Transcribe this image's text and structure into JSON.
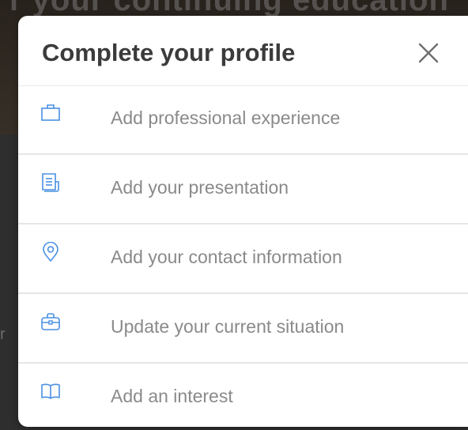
{
  "backdrop": {
    "heading_fragment": "r your continuing education",
    "side_fragment": "r"
  },
  "modal": {
    "title": "Complete your profile",
    "close_icon": "close-icon",
    "accent_color": "#4a90e2",
    "items": [
      {
        "label": "Add professional experience",
        "icon": "briefcase-icon"
      },
      {
        "label": "Add your presentation",
        "icon": "document-icon"
      },
      {
        "label": "Add your contact information",
        "icon": "location-pin-icon"
      },
      {
        "label": "Update your current situation",
        "icon": "toolbox-icon"
      },
      {
        "label": "Add an interest",
        "icon": "open-book-icon"
      }
    ]
  }
}
